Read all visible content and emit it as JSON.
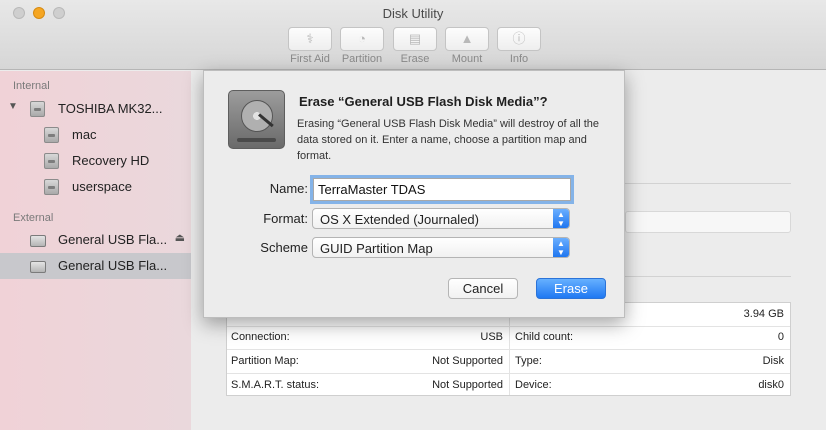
{
  "window": {
    "title": "Disk Utility"
  },
  "toolbar": [
    {
      "label": "First Aid",
      "icon": "stethoscope-icon"
    },
    {
      "label": "Partition",
      "icon": "pie-chart-icon"
    },
    {
      "label": "Erase",
      "icon": "erase-disk-icon"
    },
    {
      "label": "Mount",
      "icon": "mount-icon"
    },
    {
      "label": "Info",
      "icon": "info-icon"
    }
  ],
  "sidebar": {
    "internal_label": "Internal",
    "external_label": "External",
    "internal_items": [
      {
        "label": "TOSHIBA MK32..."
      },
      {
        "label": "mac"
      },
      {
        "label": "Recovery HD"
      },
      {
        "label": "userspace"
      }
    ],
    "external_items": [
      {
        "label": "General USB Fla..."
      },
      {
        "label": "General USB Fla..."
      }
    ]
  },
  "info": {
    "capacity": "3.94 GB",
    "rows": [
      {
        "left_label": "Connection:",
        "left_value": "USB",
        "right_label": "Child count:",
        "right_value": "0"
      },
      {
        "left_label": "Partition Map:",
        "left_value": "Not Supported",
        "right_label": "Type:",
        "right_value": "Disk"
      },
      {
        "left_label": "S.M.A.R.T. status:",
        "left_value": "Not Supported",
        "right_label": "Device:",
        "right_value": "disk0"
      }
    ]
  },
  "dialog": {
    "title": "Erase “General USB Flash Disk Media”?",
    "message": "Erasing “General USB Flash Disk Media” will destroy of all the data stored on it. Enter a name, choose a partition map and format.",
    "name_label": "Name:",
    "name_value": "TerraMaster TDAS",
    "format_label": "Format:",
    "format_value": "OS X Extended (Journaled)",
    "scheme_label": "Scheme",
    "scheme_value": "GUID Partition Map",
    "cancel_label": "Cancel",
    "erase_label": "Erase"
  },
  "colors": {
    "accent": "#1f78f2",
    "sidebar_tint": "#f0d2d7",
    "focus_ring": "#84b3e8"
  }
}
